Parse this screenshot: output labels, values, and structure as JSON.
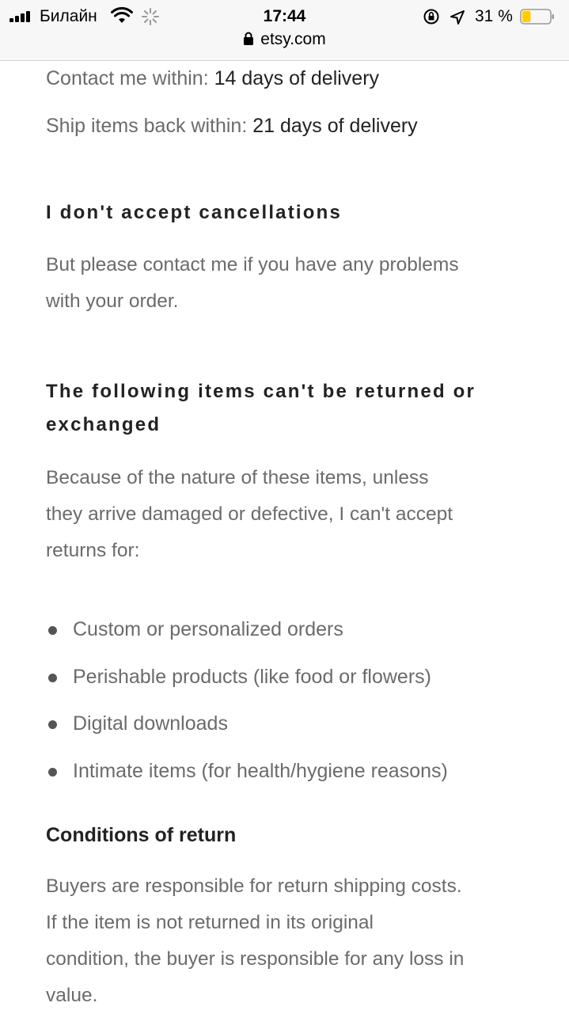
{
  "status_bar": {
    "carrier": "Билайн",
    "time": "17:44",
    "battery_percent": "31 %",
    "battery_level": 0.31,
    "battery_color": "#ffcc00"
  },
  "browser": {
    "url": "etsy.com"
  },
  "returns": {
    "contact_label": "Contact me within:",
    "contact_value": "14 days of delivery",
    "ship_label": "Ship items back within:",
    "ship_value": "21 days of delivery"
  },
  "cancellations": {
    "heading": "I don't accept cancellations",
    "body_line1": "But please contact me if you have any problems",
    "body_line2": "with your order."
  },
  "non_returnable": {
    "heading_line1": "The following items can't be returned or",
    "heading_line2": "exchanged",
    "body_line1": "Because of the nature of these items, unless",
    "body_line2": "they arrive damaged or defective, I can't accept",
    "body_line3": "returns for:",
    "items": [
      "Custom or personalized orders",
      "Perishable products (like food or flowers)",
      "Digital downloads",
      "Intimate items (for health/hygiene reasons)"
    ]
  },
  "conditions": {
    "heading": "Conditions of return",
    "body_line1": "Buyers are responsible for return shipping costs.",
    "body_line2": "If the item is not returned in its original",
    "body_line3": "condition, the buyer is responsible for any loss in",
    "body_line4": "value."
  }
}
